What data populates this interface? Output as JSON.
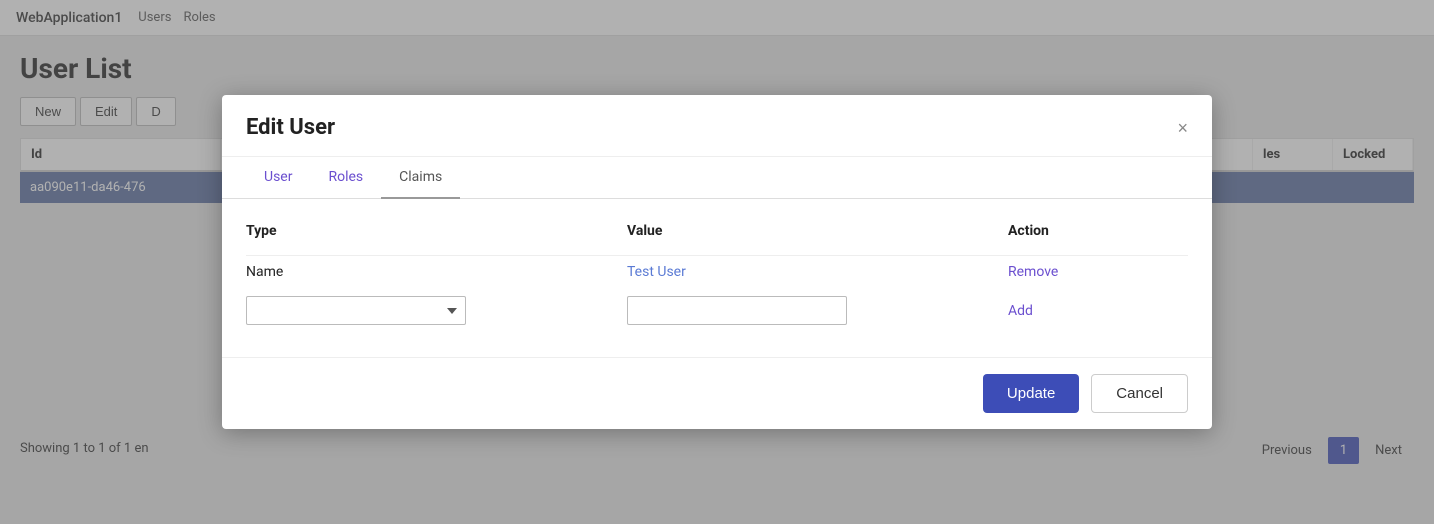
{
  "app": {
    "title": "WebApplication1",
    "nav": [
      "Users",
      "Roles"
    ]
  },
  "page": {
    "title": "User List",
    "showing": "Showing 1 to 1 of 1 en"
  },
  "toolbar": {
    "buttons": [
      "New",
      "Edit",
      "D"
    ]
  },
  "table": {
    "headers": [
      "Id",
      "",
      "les",
      "Locked"
    ],
    "rows": [
      {
        "id": "aa090e11-da46-476",
        "col2": "",
        "col3": "",
        "col4": ""
      }
    ]
  },
  "pagination": {
    "prev": "Previous",
    "current": "1",
    "next": "Next"
  },
  "modal": {
    "title": "Edit User",
    "close_label": "×",
    "tabs": [
      {
        "label": "User",
        "active": false
      },
      {
        "label": "Roles",
        "active": false
      },
      {
        "label": "Claims",
        "active": true
      }
    ],
    "claims": {
      "columns": {
        "type": "Type",
        "value": "Value",
        "action": "Action"
      },
      "rows": [
        {
          "type": "Name",
          "value": "Test User",
          "action": "Remove"
        }
      ],
      "input_row": {
        "type_placeholder": "",
        "value_placeholder": "",
        "action": "Add"
      }
    },
    "footer": {
      "update": "Update",
      "cancel": "Cancel"
    }
  }
}
